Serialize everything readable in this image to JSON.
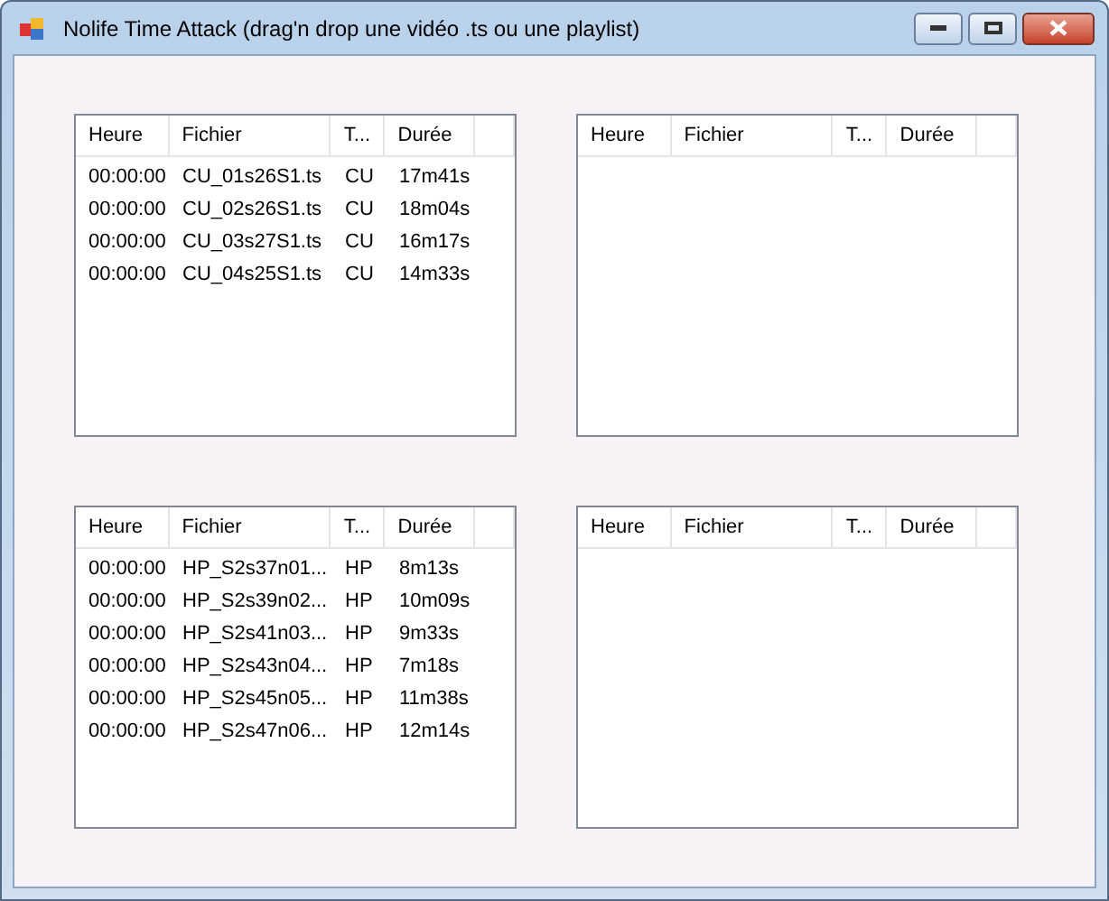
{
  "window": {
    "title": "Nolife Time Attack (drag'n drop une vidéo .ts ou une playlist)"
  },
  "lists": [
    {
      "columns": [
        "Heure",
        "Fichier",
        "T...",
        "Durée"
      ],
      "rows": [
        [
          "00:00:00",
          "CU_01s26S1.ts",
          "CU",
          "17m41s"
        ],
        [
          "00:00:00",
          "CU_02s26S1.ts",
          "CU",
          "18m04s"
        ],
        [
          "00:00:00",
          "CU_03s27S1.ts",
          "CU",
          "16m17s"
        ],
        [
          "00:00:00",
          "CU_04s25S1.ts",
          "CU",
          "14m33s"
        ]
      ]
    },
    {
      "columns": [
        "Heure",
        "Fichier",
        "T...",
        "Durée"
      ]
    },
    {
      "columns": [
        "Heure",
        "Fichier",
        "T...",
        "Durée"
      ],
      "rows": [
        [
          "00:00:00",
          "HP_S2s37n01...",
          "HP",
          "8m13s"
        ],
        [
          "00:00:00",
          "HP_S2s39n02...",
          "HP",
          "10m09s"
        ],
        [
          "00:00:00",
          "HP_S2s41n03...",
          "HP",
          "9m33s"
        ],
        [
          "00:00:00",
          "HP_S2s43n04...",
          "HP",
          "7m18s"
        ],
        [
          "00:00:00",
          "HP_S2s45n05...",
          "HP",
          "11m38s"
        ],
        [
          "00:00:00",
          "HP_S2s47n06...",
          "HP",
          "12m14s"
        ]
      ]
    },
    {
      "columns": [
        "Heure",
        "Fichier",
        "T...",
        "Durée"
      ]
    }
  ]
}
